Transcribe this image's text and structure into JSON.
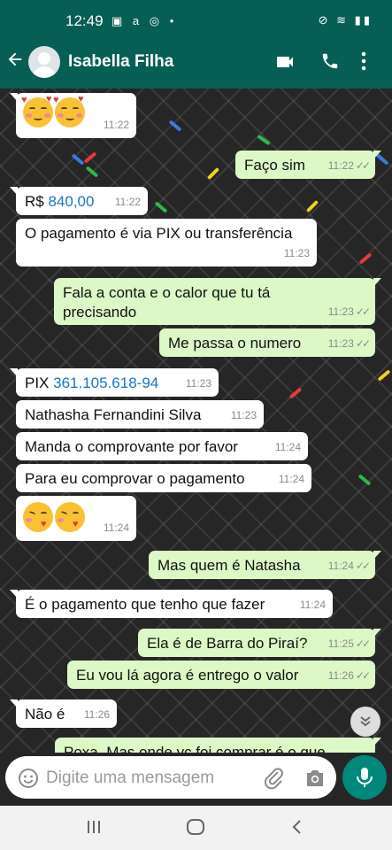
{
  "status_bar": {
    "time": "12:49",
    "left_icons": "▣ a ◎ •",
    "right_icons": "⊘ ≋ ▮▮"
  },
  "header": {
    "contact_name": "Isabella Filha"
  },
  "messages": [
    {
      "id": "m1",
      "dir": "in",
      "emoji_faces": [
        "smiling-face-with-hearts",
        "smiling-face-with-hearts"
      ],
      "time": "11:22"
    },
    {
      "id": "m2",
      "dir": "out",
      "text": "Faço sim",
      "time": "11:22"
    },
    {
      "id": "m3",
      "dir": "in",
      "prefix": "R$ ",
      "link": "840,00",
      "time": "11:22"
    },
    {
      "id": "m4",
      "dir": "in",
      "text": "O pagamento é via PIX ou transferência",
      "time": "11:23"
    },
    {
      "id": "m5",
      "dir": "out",
      "text": "Fala a conta e o calor que tu tá precisando",
      "time": "11:23"
    },
    {
      "id": "m6",
      "dir": "out",
      "text": "Me passa o numero",
      "time": "11:23"
    },
    {
      "id": "m7",
      "dir": "in",
      "prefix": "PIX ",
      "link": "361.105.618-94",
      "time": "11:23"
    },
    {
      "id": "m8",
      "dir": "in",
      "text": "Nathasha Fernandini Silva",
      "time": "11:23"
    },
    {
      "id": "m9",
      "dir": "in",
      "text": "Manda o comprovante por favor",
      "time": "11:24"
    },
    {
      "id": "m10",
      "dir": "in",
      "text": "Para eu comprovar o pagamento",
      "time": "11:24"
    },
    {
      "id": "m11",
      "dir": "in",
      "emoji_faces": [
        "face-blowing-a-kiss",
        "face-blowing-a-kiss"
      ],
      "time": "11:24"
    },
    {
      "id": "m12",
      "dir": "out",
      "text": "Mas quem é Natasha",
      "time": "11:24"
    },
    {
      "id": "m13",
      "dir": "in",
      "text": "É o pagamento que tenho que fazer",
      "time": "11:24"
    },
    {
      "id": "m14",
      "dir": "out",
      "text": "Ela é de Barra do Piraí?",
      "time": "11:25"
    },
    {
      "id": "m15",
      "dir": "out",
      "text": "Eu vou lá agora é entrego o valor",
      "time": "11:26"
    },
    {
      "id": "m16",
      "dir": "in",
      "text": "Não é",
      "time": "11:26"
    },
    {
      "id": "m17",
      "dir": "out",
      "text": "Poxa. Mas onde vc foi comprar é o que"
    }
  ],
  "ticks": "✓✓",
  "input": {
    "placeholder": "Digite uma mensagem"
  },
  "colors": {
    "header": "#075e54",
    "outgoing_bubble": "#dcf8c6",
    "incoming_bubble": "#ffffff",
    "link": "#1a73c8",
    "mic_button": "#00897b"
  }
}
